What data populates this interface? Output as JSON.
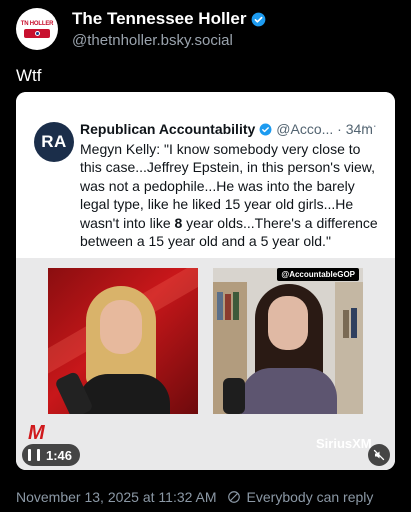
{
  "post": {
    "author": {
      "display_name": "The Tennessee Holler",
      "handle": "@thetnholler.bsky.social",
      "avatar_text": "TN HOLLER"
    },
    "text": "Wtf",
    "footer": {
      "timestamp": "November 13, 2025 at 11:32 AM",
      "separator": "⦸",
      "reply_setting": "Everybody can reply"
    }
  },
  "embed": {
    "quote": {
      "avatar_initials": "RA",
      "name": "Republican Accountability",
      "handle_time": "@Acco... · 34m",
      "more": "···",
      "body_before_bold": "Megyn Kelly: \"I know somebody very close to this case...Jeffrey Epstein, in this person's view, was not a pedophile...He was into the barely legal type, like he liked 15 year old girls...He wasn't into like ",
      "body_bold": "8",
      "body_after_bold": " year olds...There's a difference between a 15 year old and a 5 year old.\""
    },
    "video": {
      "tag": "@AccountableGOP",
      "brand": "SiriusXM",
      "logo_mark": "M",
      "duration": "1:46"
    }
  },
  "colors": {
    "background": "#000000",
    "verified": "#1d9bf0",
    "muted_text": "#8b98a5"
  }
}
